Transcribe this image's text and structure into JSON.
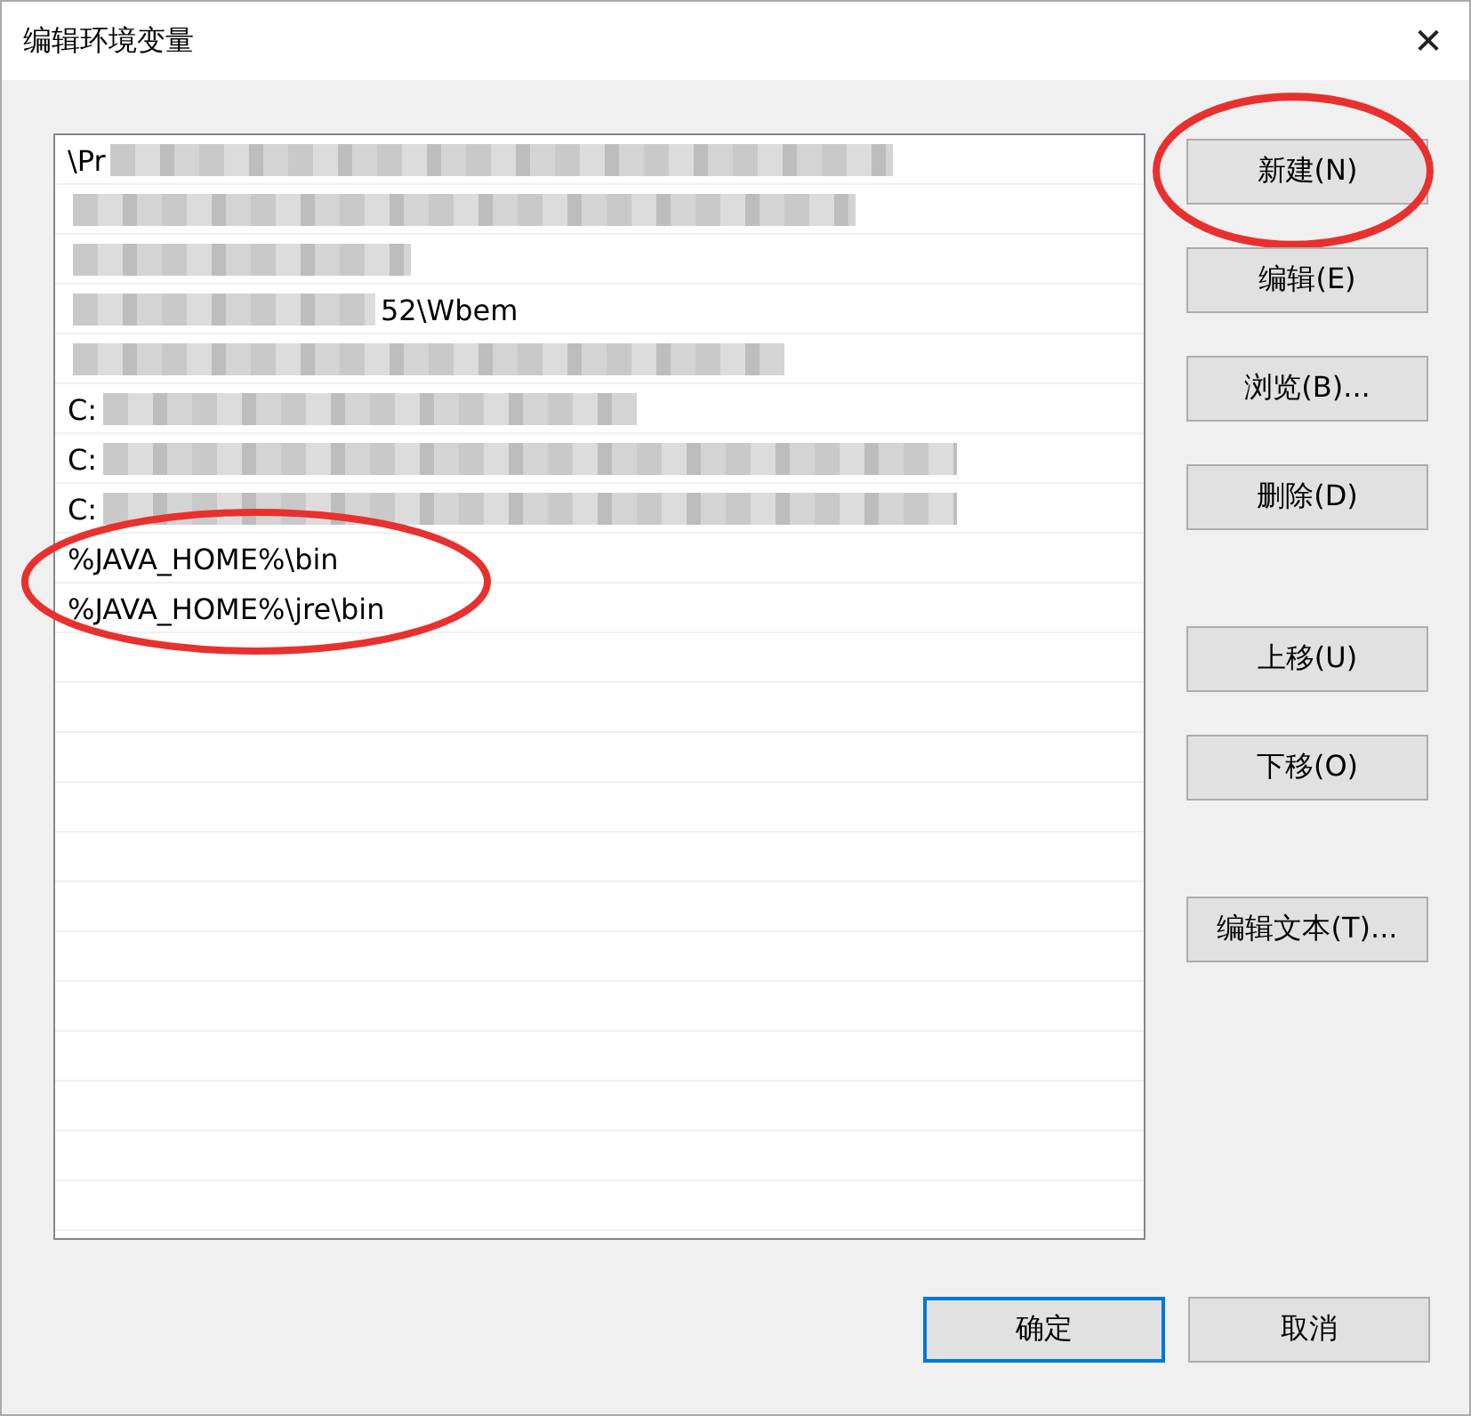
{
  "window": {
    "title": "编辑环境变量",
    "close": "✕"
  },
  "rows": [
    {
      "kind": "redacted",
      "lead": "\\Pr",
      "selected": false,
      "circled": false
    },
    {
      "kind": "redacted",
      "selected": false,
      "circled": false
    },
    {
      "kind": "redacted",
      "selected": false,
      "circled": false
    },
    {
      "kind": "redacted",
      "trail": "52\\Wbem",
      "selected": false,
      "circled": false
    },
    {
      "kind": "redacted",
      "selected": false,
      "circled": false
    },
    {
      "kind": "redacted",
      "lead": "C:",
      "selected": false,
      "circled": false
    },
    {
      "kind": "redacted",
      "lead": "C:",
      "selected": false,
      "circled": false
    },
    {
      "kind": "redacted",
      "lead": "C:",
      "selected": false,
      "circled": false
    },
    {
      "kind": "plain",
      "text": "%JAVA_HOME%\\bin",
      "selected": false,
      "circled": true
    },
    {
      "kind": "plain",
      "text": "%JAVA_HOME%\\jre\\bin",
      "selected": false,
      "circled": true
    }
  ],
  "side_button_groups": [
    [
      {
        "label": "新建(N)",
        "circled": true
      },
      {
        "label": "编辑(E)",
        "circled": false
      },
      {
        "label": "浏览(B)...",
        "circled": false
      },
      {
        "label": "删除(D)",
        "circled": false
      }
    ],
    [
      {
        "label": "上移(U)",
        "circled": false
      },
      {
        "label": "下移(O)",
        "circled": false
      }
    ],
    [
      {
        "label": "编辑文本(T)...",
        "circled": false
      }
    ]
  ],
  "footer_buttons": [
    {
      "label": "确定",
      "default": true
    },
    {
      "label": "取消",
      "default": false
    }
  ]
}
